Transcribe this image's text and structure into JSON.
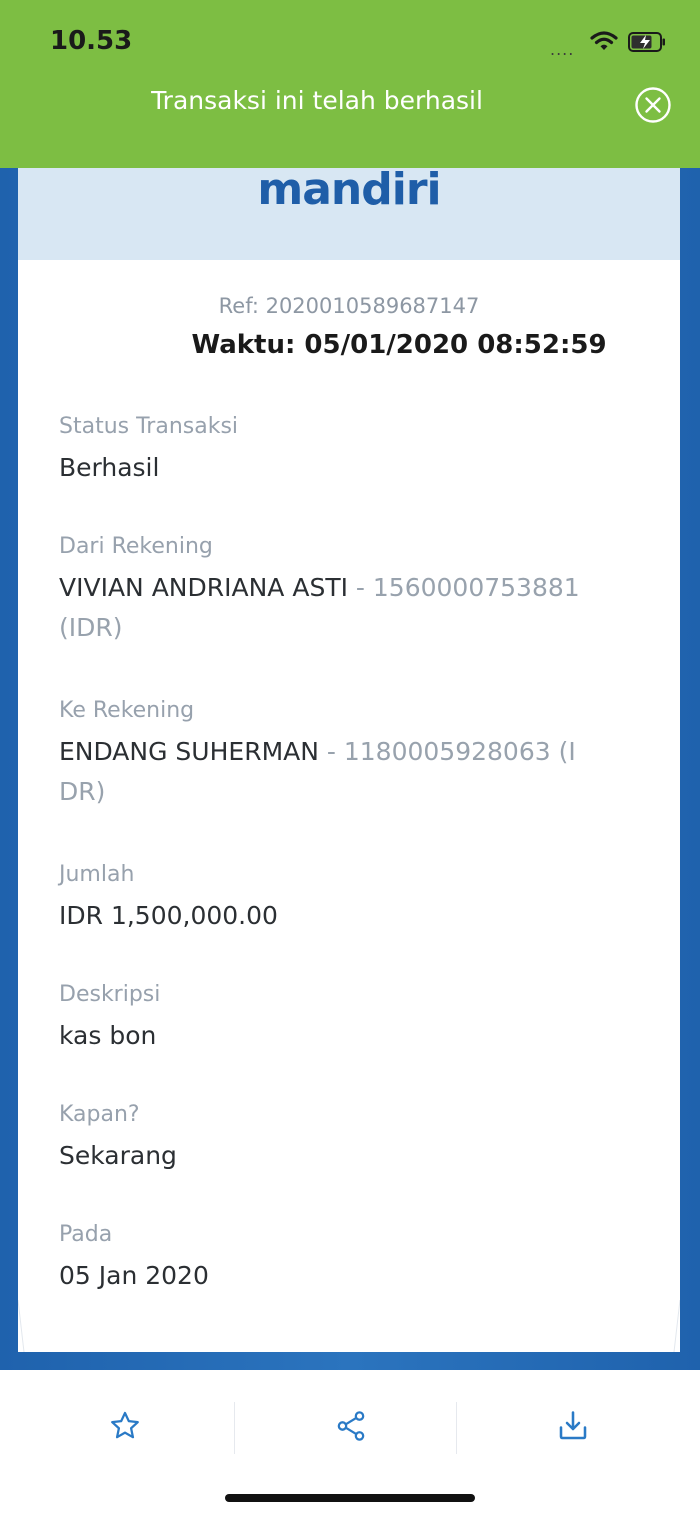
{
  "status_bar": {
    "time": "10.53",
    "signal_dots": "....",
    "wifi_icon": "wifi-icon",
    "battery_icon": "battery-charging-icon"
  },
  "banner": {
    "message": "Transaksi ini telah berhasil",
    "close_icon": "close-circle-icon",
    "color": "#7dbe43"
  },
  "header": {
    "logo_text": "mandiri"
  },
  "receipt": {
    "ref": "Ref: 2020010589687147",
    "time": "Waktu: 05/01/2020 08:52:59",
    "status_label": "Status Transaksi",
    "status_value": "Berhasil",
    "from_label": "Dari Rekening",
    "from_name": "VIVIAN ANDRIANA ASTI",
    "from_account_line1": " - 1560000753881",
    "from_account_line2": "(IDR)",
    "to_label": "Ke Rekening",
    "to_name": "ENDANG SUHERMAN",
    "to_account_line1": " - 1180005928063 (I",
    "to_account_line2": "DR)",
    "amount_label": "Jumlah",
    "amount_value": "IDR 1,500,000.00",
    "desc_label": "Deskripsi",
    "desc_value": "kas bon",
    "when_label": "Kapan?",
    "when_value": "Sekarang",
    "on_label": "Pada",
    "on_value": "05 Jan 2020"
  },
  "actions": {
    "favorite_icon": "star-icon",
    "share_icon": "share-icon",
    "download_icon": "download-icon",
    "accent": "#2a7ac6"
  }
}
